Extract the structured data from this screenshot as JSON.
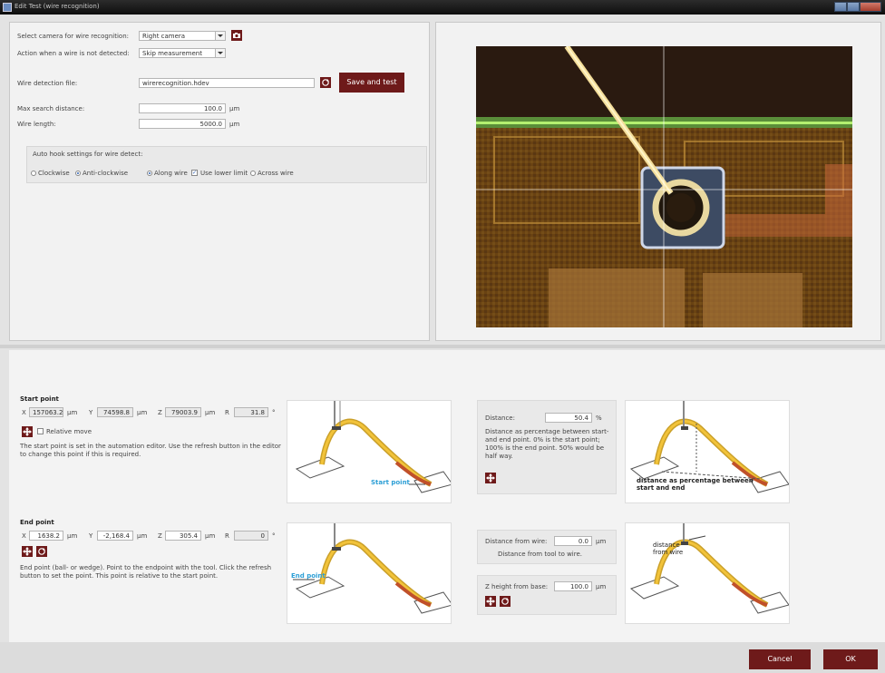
{
  "window": {
    "title": "Edit Test (wire recognition)"
  },
  "top_form": {
    "camera_label": "Select camera for wire recognition:",
    "camera_value": "Right camera",
    "action_label": "Action when a wire is not detected:",
    "action_value": "Skip measurement",
    "detection_file_label": "Wire detection file:",
    "detection_file_value": "wirerecognition.hdev",
    "save_test_label": "Save and test",
    "max_search_label": "Max search distance:",
    "max_search_value": "100.0",
    "max_search_unit": "µm",
    "wire_length_label": "Wire length:",
    "wire_length_value": "5000.0",
    "wire_length_unit": "µm",
    "autohook": {
      "title": "Auto hook settings for wire detect:",
      "clockwise": "Clockwise",
      "anticlockwise": "Anti-clockwise",
      "along_wire": "Along wire",
      "use_lower_limit": "Use lower limit",
      "across_wire": "Across wire"
    }
  },
  "start_point": {
    "title": "Start point",
    "x_label": "X",
    "x_value": "157063.2",
    "x_unit": "µm",
    "y_label": "Y",
    "y_value": "74598.8",
    "y_unit": "µm",
    "z_label": "Z",
    "z_value": "79003.9",
    "z_unit": "µm",
    "r_label": "R",
    "r_value": "31.8",
    "r_unit": "°",
    "relative_move": "Relative move",
    "description": "The start point is set in the automation editor. Use the refresh button in the editor to change this point if this is required.",
    "diagram_label": "Start point"
  },
  "end_point": {
    "title": "End point",
    "x_label": "X",
    "x_value": "1638.2",
    "x_unit": "µm",
    "y_label": "Y",
    "y_value": "-2,168.4",
    "y_unit": "µm",
    "z_label": "Z",
    "z_value": "305.4",
    "z_unit": "µm",
    "r_label": "R",
    "r_value": "0",
    "r_unit": "°",
    "description": "End point (ball- or wedge). Point to the endpoint with the tool. Click the refresh button to set the point. This point is relative to the start point.",
    "diagram_label": "End point"
  },
  "distance": {
    "label": "Distance:",
    "value": "50.4",
    "unit": "%",
    "description": "Distance as percentage between start- and end point. 0% is the start point; 100% is the end point. 50% would be half way.",
    "diagram_label": "distance as percentage between start and end"
  },
  "distance_from_wire": {
    "label": "Distance from wire:",
    "value": "0.0",
    "unit": "µm",
    "description": "Distance from tool to wire.",
    "diagram_label": "distance from wire"
  },
  "z_height": {
    "label": "Z height from base:",
    "value": "100.0",
    "unit": "µm"
  },
  "footer": {
    "cancel": "Cancel",
    "ok": "OK"
  },
  "colors": {
    "accent": "#6e1a1a",
    "wire": "#e0a41c",
    "wire_tip": "#c0502a",
    "label_blue": "#2d9fd6"
  }
}
